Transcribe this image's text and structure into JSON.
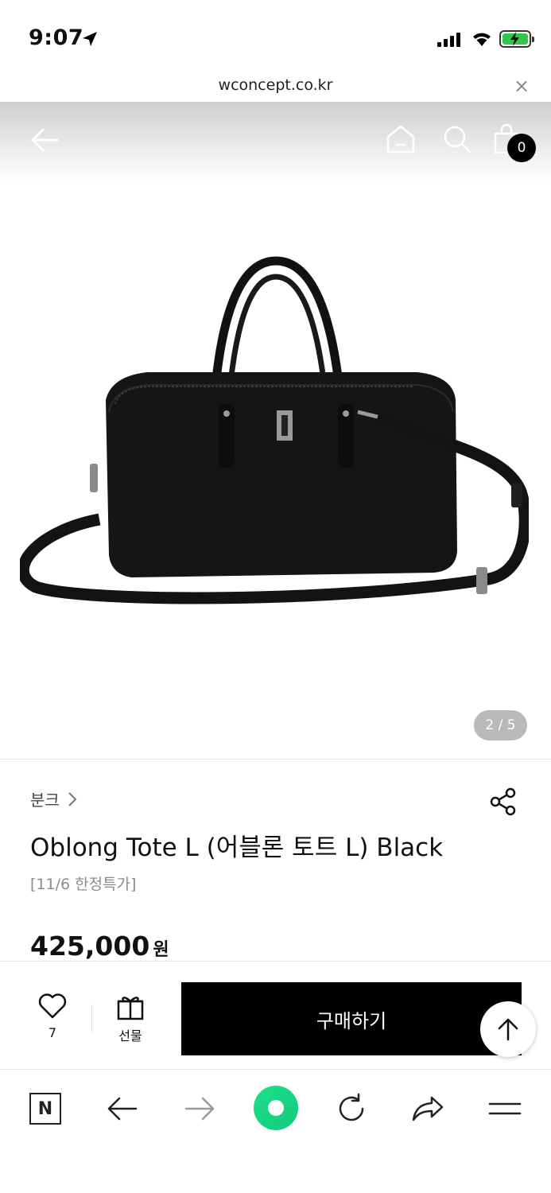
{
  "status_bar": {
    "time": "9:07",
    "battery_color": "#32c74a"
  },
  "url_bar": {
    "domain": "wconcept.co.kr",
    "close_glyph": "×"
  },
  "product_nav": {
    "cart_count": "0",
    "icons": [
      "back-arrow-icon",
      "home-icon",
      "search-icon",
      "shopping-bag-icon"
    ]
  },
  "gallery": {
    "indicator": "2 / 5",
    "current_index": 2,
    "total": 5
  },
  "product": {
    "brand": "분크",
    "title": "Oblong Tote L (어블론 토트 L) Black",
    "subtitle": "[11/6 한정특가]",
    "price": "425,000",
    "currency": "원"
  },
  "purchase_bar": {
    "like_count": "7",
    "gift_label": "선물",
    "buy_label": "구매하기",
    "buy_bg": "#000000"
  },
  "browser_toolbar": {
    "n_label": "N",
    "icons": [
      "naver-n-icon",
      "back-icon",
      "forward-icon",
      "green-dot-icon",
      "reload-icon",
      "share-arrow-icon",
      "menu-icon"
    ],
    "accent": "#1fe08a"
  }
}
